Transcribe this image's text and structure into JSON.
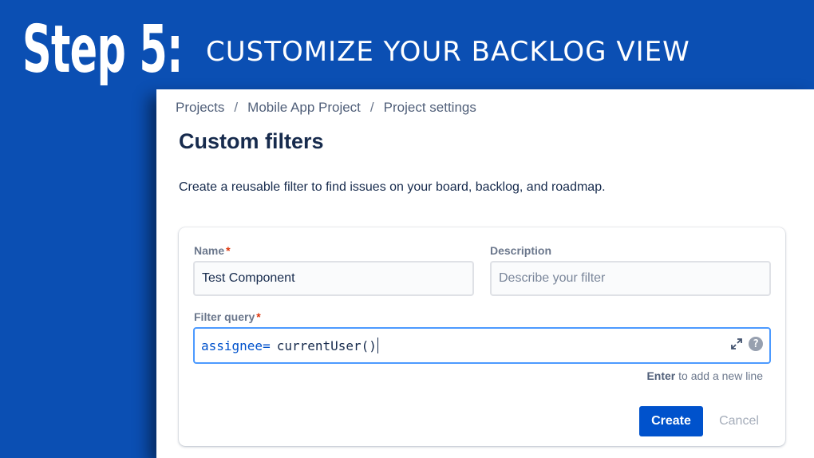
{
  "hero": {
    "step": "Step 5:",
    "subtitle": "CUSTOMIZE YOUR BACKLOG VIEW"
  },
  "breadcrumb": {
    "items": [
      "Projects",
      "Mobile App Project",
      "Project settings"
    ],
    "separator": "/"
  },
  "page": {
    "title": "Custom filters",
    "description": "Create a reusable filter to find issues on your board, backlog, and roadmap."
  },
  "form": {
    "name_label": "Name",
    "name_value": "Test Component",
    "description_label": "Description",
    "description_placeholder": "Describe your filter",
    "required_mark": "*",
    "query_label": "Filter query",
    "query_keyword": "assignee",
    "query_operator": "=",
    "query_function": "currentUser()",
    "help_glyph": "?",
    "hint_key": "Enter",
    "hint_text": " to add a new line",
    "create_label": "Create",
    "cancel_label": "Cancel"
  },
  "icons": {
    "expand": "expand-arrows-icon",
    "help": "question-circle-icon"
  },
  "colors": {
    "background": "#0b4fb3",
    "primary": "#0052cc",
    "focus_border": "#4c9aff",
    "required": "#de350b"
  }
}
